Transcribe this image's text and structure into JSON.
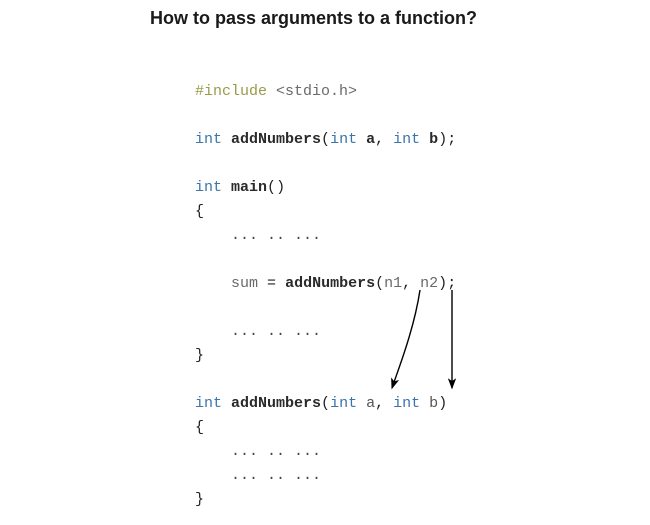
{
  "title": "How to pass arguments to a function?",
  "code": {
    "pp": "#include",
    "inc_hdr": "<stdio.h>",
    "kw_int": "int",
    "fn_addNumbers": "addNumbers",
    "fn_main": "main",
    "id_a": "a",
    "id_b": "b",
    "id_sum": "sum",
    "id_n1": "n1",
    "id_n2": "n2",
    "eq": "=",
    "comma": ",",
    "lpar": "(",
    "rpar": ")",
    "lbrace": "{",
    "rbrace": "}",
    "semi": ";",
    "ellipsis": "... .. ..."
  }
}
